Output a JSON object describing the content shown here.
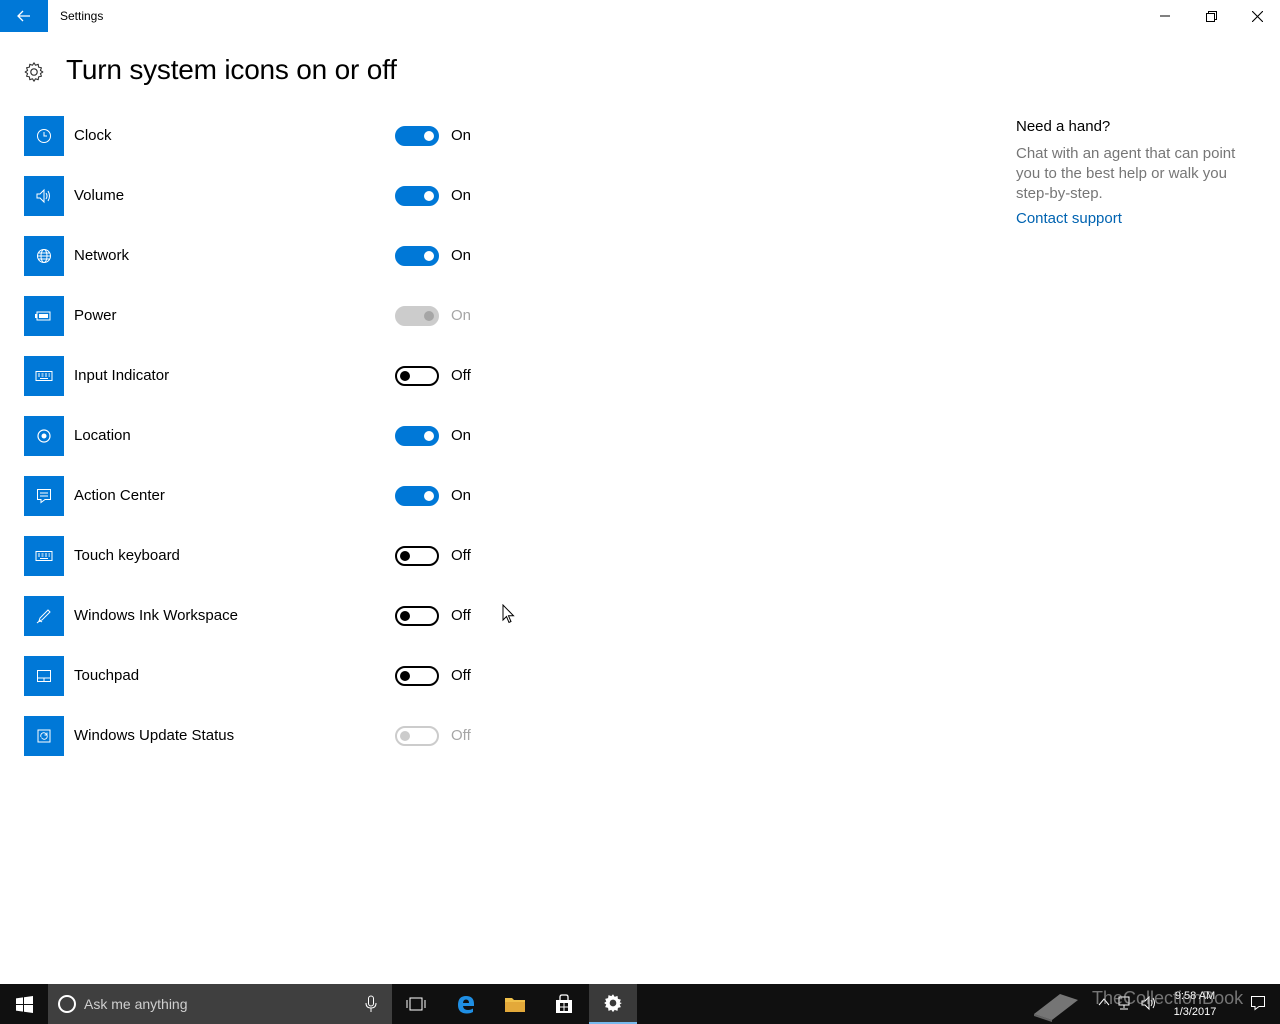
{
  "window": {
    "title": "Settings"
  },
  "page": {
    "title": "Turn system icons on or off"
  },
  "items": [
    {
      "label": "Clock",
      "state": "On",
      "on": true,
      "disabled": false,
      "icon": "clock-icon"
    },
    {
      "label": "Volume",
      "state": "On",
      "on": true,
      "disabled": false,
      "icon": "volume-icon"
    },
    {
      "label": "Network",
      "state": "On",
      "on": true,
      "disabled": false,
      "icon": "globe-icon"
    },
    {
      "label": "Power",
      "state": "On",
      "on": true,
      "disabled": true,
      "icon": "battery-icon"
    },
    {
      "label": "Input Indicator",
      "state": "Off",
      "on": false,
      "disabled": false,
      "icon": "keyboard-icon"
    },
    {
      "label": "Location",
      "state": "On",
      "on": true,
      "disabled": false,
      "icon": "location-icon"
    },
    {
      "label": "Action Center",
      "state": "On",
      "on": true,
      "disabled": false,
      "icon": "action-center-icon"
    },
    {
      "label": "Touch keyboard",
      "state": "Off",
      "on": false,
      "disabled": false,
      "icon": "keyboard-icon"
    },
    {
      "label": "Windows Ink Workspace",
      "state": "Off",
      "on": false,
      "disabled": false,
      "icon": "pen-icon"
    },
    {
      "label": "Touchpad",
      "state": "Off",
      "on": false,
      "disabled": false,
      "icon": "touchpad-icon"
    },
    {
      "label": "Windows Update Status",
      "state": "Off",
      "on": false,
      "disabled": true,
      "icon": "update-icon"
    }
  ],
  "help": {
    "title": "Need a hand?",
    "text": "Chat with an agent that can point you to the best help or walk you step-by-step.",
    "link": "Contact support"
  },
  "taskbar": {
    "search_placeholder": "Ask me anything",
    "time": "9:58 AM",
    "date": "1/3/2017",
    "watermark": "TheCollectionBook"
  },
  "colors": {
    "accent": "#0078d7",
    "link": "#0063b1",
    "muted": "#767676",
    "disabled": "#a6a6a6"
  }
}
